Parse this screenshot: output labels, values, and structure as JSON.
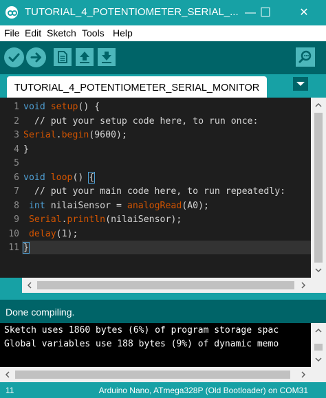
{
  "window": {
    "title": "TUTORIAL_4_POTENTIOMETER_SERIAL_...",
    "minimize_glyph": "—",
    "maximize_glyph": "☐",
    "close_glyph": "✕"
  },
  "menu": [
    "File",
    "Edit",
    "Sketch",
    "Tools",
    "Help"
  ],
  "toolbar": {
    "icons": [
      "verify-icon",
      "upload-icon",
      "new-icon",
      "open-icon",
      "save-icon",
      "serial-monitor-icon"
    ]
  },
  "tab": {
    "label": "TUTORIAL_4_POTENTIOMETER_SERIAL_MONITOR"
  },
  "editor": {
    "line_numbers": [
      "1",
      "2",
      "3",
      "4",
      "5",
      "6",
      "7",
      "8",
      "9",
      "10",
      "11"
    ],
    "current_line": "11"
  },
  "status": {
    "message": "Done compiling."
  },
  "console": {
    "lines": [
      "Sketch uses 1860 bytes (6%) of program storage spac",
      "Global variables use 188 bytes (9%) of dynamic memo"
    ]
  },
  "bottom": {
    "line": "11",
    "board": "Arduino Nano, ATmega328P (Old Bootloader) on COM31"
  },
  "colors": {
    "teal": "#17a1a5",
    "dark_teal": "#006468",
    "keyword": "#4f9fd3",
    "function": "#d35400",
    "comment": "#d4d4d4"
  }
}
